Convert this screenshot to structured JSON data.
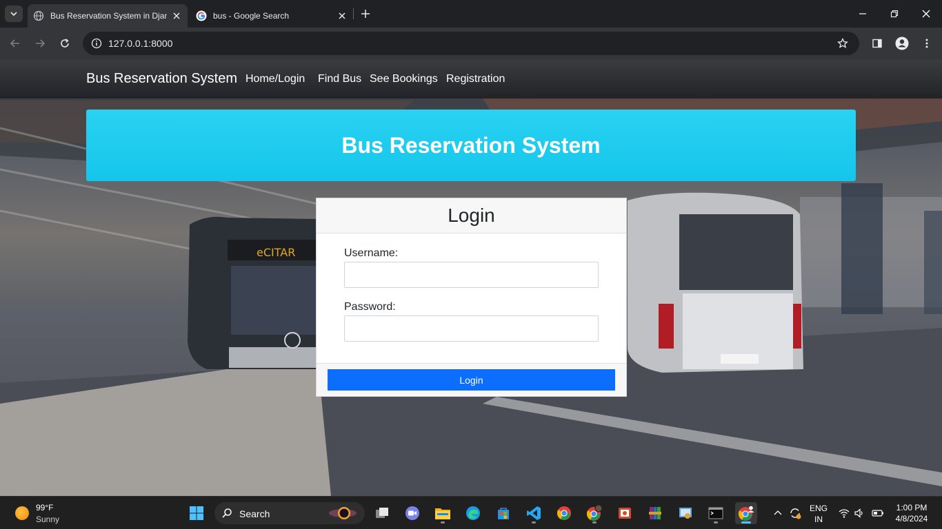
{
  "browser": {
    "tabs": [
      {
        "title": "Bus Reservation System in Djan",
        "active": true
      },
      {
        "title": "bus - Google Search",
        "active": false
      }
    ],
    "url": "127.0.0.1:8000"
  },
  "navbar": {
    "brand": "Bus Reservation System",
    "links": [
      "Home/Login",
      "Find Bus",
      "See Bookings",
      "Registration"
    ]
  },
  "hero": {
    "title": "Bus Reservation System"
  },
  "login": {
    "title": "Login",
    "username_label": "Username:",
    "username_value": "",
    "password_label": "Password:",
    "password_value": "",
    "button_label": "Login"
  },
  "taskbar": {
    "weather": {
      "temp": "99°F",
      "condition": "Sunny"
    },
    "search_label": "Search",
    "language": "ENG",
    "region": "IN",
    "time": "1:00 PM",
    "date": "4/8/2024"
  },
  "colors": {
    "hero": "#1fcfee",
    "primary_button": "#0d6efd",
    "navbar": "#2b2d31"
  }
}
